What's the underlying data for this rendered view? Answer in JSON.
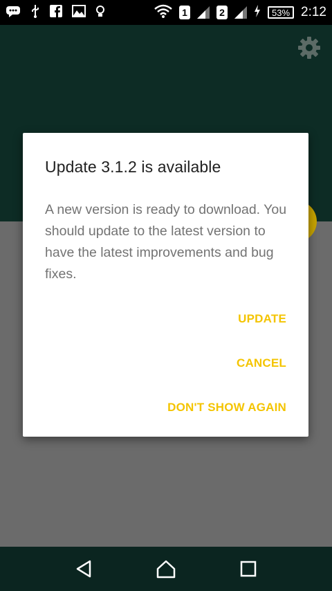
{
  "status_bar": {
    "sim1": "1",
    "sim2": "2",
    "battery": "53%",
    "time": "2:12",
    "icons": [
      "chat-icon",
      "usb-icon",
      "facebook-icon",
      "gallery-icon",
      "bulb-icon",
      "wifi-icon",
      "signal-icon",
      "charging-icon"
    ]
  },
  "dialog": {
    "title": "Update 3.1.2 is available",
    "message": "A new version is ready to download. You should update to the latest version to have the latest improvements and bug fixes.",
    "update_label": "UPDATE",
    "cancel_label": "CANCEL",
    "dont_show_label": "DON'T SHOW AGAIN"
  },
  "colors": {
    "header": "#0d2c25",
    "accent": "#f4c400",
    "fab": "#c6a300",
    "body": "#6b6b6b"
  },
  "nav": [
    "back-icon",
    "home-icon",
    "recents-icon"
  ]
}
